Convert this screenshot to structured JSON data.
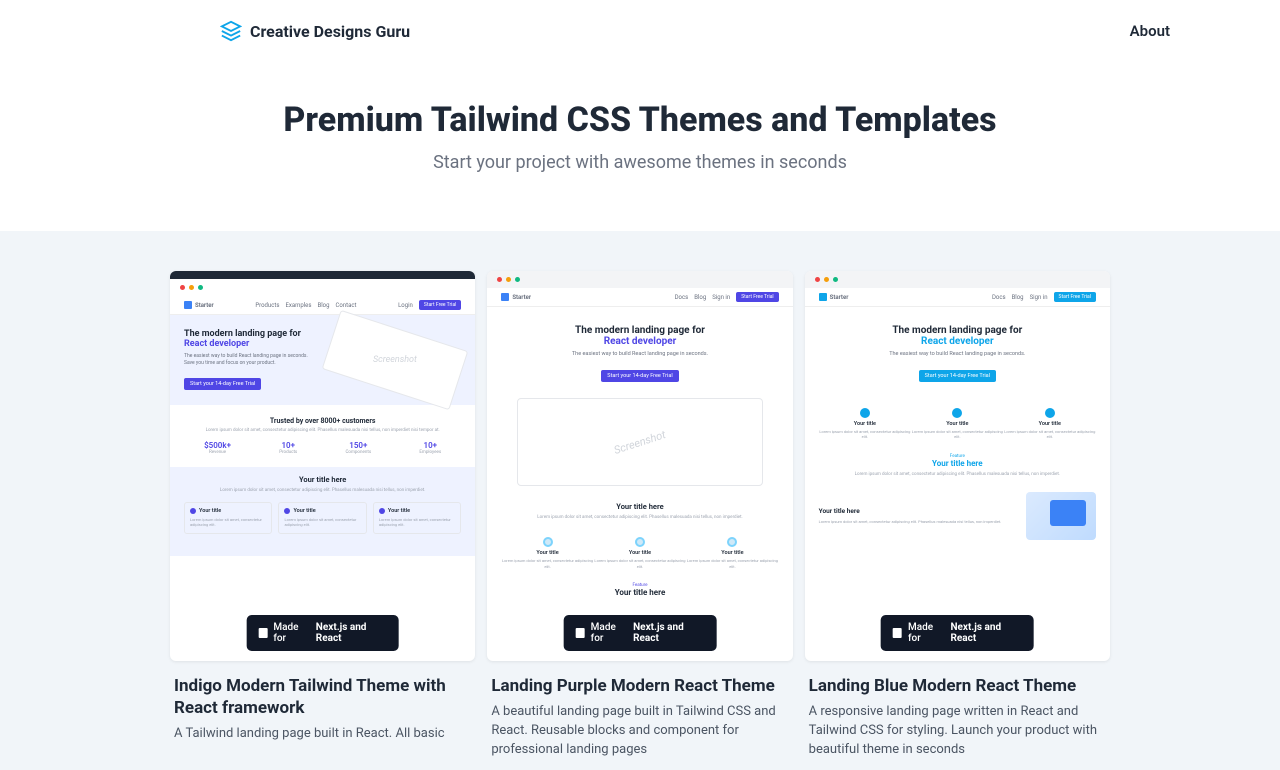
{
  "brand": "Creative Designs Guru",
  "nav": {
    "about": "About"
  },
  "hero": {
    "title": "Premium Tailwind CSS Themes and Templates",
    "subtitle": "Start your project with awesome themes in seconds"
  },
  "badge_prefix": "Made for ",
  "badge_bold": "Next.js and React",
  "preview": {
    "starter": "Starter",
    "nav_items": [
      "Products",
      "Examples",
      "Blog",
      "Contact"
    ],
    "nav_items2": [
      "Docs",
      "Blog",
      "Sign in"
    ],
    "login": "Login",
    "cta": "Start Free Trial",
    "hero_line1": "The modern landing page for ",
    "hero_line2": "React developer",
    "hero_sub": "The easiest way to build React landing page in seconds. Save you time and focus on your product.",
    "hero_sub2": "The easiest way to build React landing page in seconds.",
    "hero_cta": "Start your 14-day Free Trial",
    "screenshot": "Screenshot",
    "trusted_title": "Trusted by over 8000+ customers",
    "trusted_sub": "Lorem ipsum dolor sit amet, consectetur adipiscing elit. Phasellus malesuada nisi tellus, non imperdiet nisi tempor at.",
    "stats": [
      {
        "val": "$500k+",
        "lbl": "Revenue"
      },
      {
        "val": "10+",
        "lbl": "Products"
      },
      {
        "val": "150+",
        "lbl": "Components"
      },
      {
        "val": "10+",
        "lbl": "Employees"
      }
    ],
    "your_title_here": "Your title here",
    "your_title": "Your title",
    "box_text": "Lorem ipsum dolor sit amet, consectetur adipiscing elit.",
    "feature": "Feature",
    "section_sub": "Lorem ipsum dolor sit amet, consectetur adipiscing elit. Phasellus malesuada nisi tellus, non imperdiet."
  },
  "themes": [
    {
      "title": "Indigo Modern Tailwind Theme with React framework",
      "desc": "A Tailwind landing page built in React. All basic"
    },
    {
      "title": "Landing Purple Modern React Theme",
      "desc": "A beautiful landing page built in Tailwind CSS and React. Reusable blocks and component for professional landing pages"
    },
    {
      "title": "Landing Blue Modern React Theme",
      "desc": "A responsive landing page written in React and Tailwind CSS for styling. Launch your product with beautiful theme in seconds"
    }
  ]
}
